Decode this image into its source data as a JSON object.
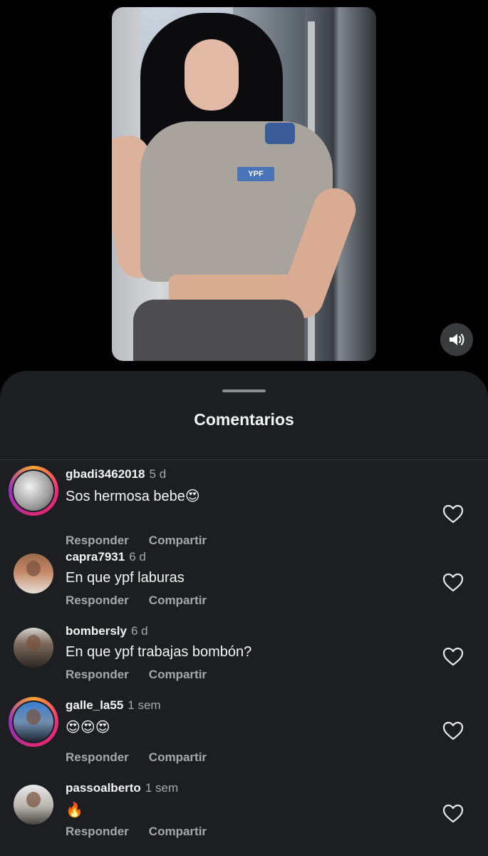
{
  "video": {
    "shirt_logo": "YPF",
    "sound_icon": "speaker-icon"
  },
  "sheet": {
    "title": "Comentarios"
  },
  "comments": [
    {
      "username": "gbadi3462018",
      "time": "5 d",
      "text": "Sos hermosa bebe😍",
      "reply_label": "Responder",
      "share_label": "Compartir",
      "has_story": true
    },
    {
      "username": "capra7931",
      "time": "6 d",
      "text": "En que ypf laburas",
      "reply_label": "Responder",
      "share_label": "Compartir",
      "has_story": false
    },
    {
      "username": "bombersly",
      "time": "6 d",
      "text": "En que ypf trabajas bombón?",
      "reply_label": "Responder",
      "share_label": "Compartir",
      "has_story": false
    },
    {
      "username": "galle_la55",
      "time": "1 sem",
      "text": "😍😍😍",
      "reply_label": "Responder",
      "share_label": "Compartir",
      "has_story": true
    },
    {
      "username": "passoalberto",
      "time": "1 sem",
      "text": "🔥",
      "reply_label": "Responder",
      "share_label": "Compartir",
      "has_story": false
    }
  ],
  "colors": {
    "background": "#000000",
    "sheet": "#1c1e21",
    "text_primary": "#f5f5f5",
    "text_secondary": "#a8a8a8"
  }
}
